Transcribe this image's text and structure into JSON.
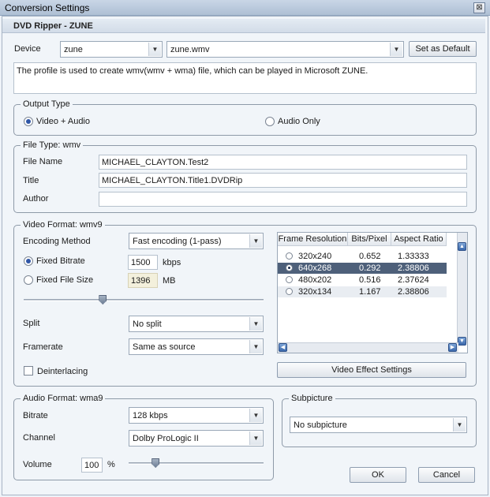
{
  "window": {
    "title": "Conversion Settings",
    "close_glyph": "⊠"
  },
  "header": {
    "title": "DVD Ripper - ZUNE"
  },
  "device": {
    "label": "Device",
    "value": "zune",
    "profile": "zune.wmv",
    "set_default_label": "Set as Default"
  },
  "description": "The profile is used to create wmv(wmv + wma) file, which can be played in Microsoft ZUNE.",
  "output_type": {
    "title": "Output Type",
    "video_audio_label": "Video + Audio",
    "audio_only_label": "Audio Only",
    "selected": "video_audio"
  },
  "file_type": {
    "title": "File Type: wmv",
    "file_name_label": "File Name",
    "file_name_value": "MICHAEL_CLAYTON.Test2",
    "title_label": "Title",
    "title_value": "MICHAEL_CLAYTON.Title1.DVDRip",
    "author_label": "Author",
    "author_value": ""
  },
  "video_format": {
    "title": "Video Format: wmv9",
    "encoding_label": "Encoding Method",
    "encoding_value": "Fast encoding (1-pass)",
    "fixed_bitrate_label": "Fixed Bitrate",
    "fixed_bitrate_value": "1500",
    "fixed_bitrate_unit": "kbps",
    "fixed_size_label": "Fixed File Size",
    "fixed_size_value": "1396",
    "fixed_size_unit": "MB",
    "bitrate_slider_fraction": 0.33,
    "split_label": "Split",
    "split_value": "No split",
    "framerate_label": "Framerate",
    "framerate_value": "Same as source",
    "deinterlacing_label": "Deinterlacing",
    "resolution_headers": [
      "Frame Resolution",
      "Bits/Pixel",
      "Aspect Ratio"
    ],
    "resolutions": [
      {
        "res": "320x240",
        "bpp": "0.652",
        "aspect": "1.33333",
        "selected": false
      },
      {
        "res": "640x268",
        "bpp": "0.292",
        "aspect": "2.38806",
        "selected": true
      },
      {
        "res": "480x202",
        "bpp": "0.516",
        "aspect": "2.37624",
        "selected": false
      },
      {
        "res": "320x134",
        "bpp": "1.167",
        "aspect": "2.38806",
        "selected": false
      }
    ],
    "effect_button_label": "Video Effect Settings"
  },
  "audio_format": {
    "title": "Audio Format: wma9",
    "bitrate_label": "Bitrate",
    "bitrate_value": "128 kbps",
    "channel_label": "Channel",
    "channel_value": "Dolby ProLogic II",
    "volume_label": "Volume",
    "volume_value": "100",
    "volume_unit": "%",
    "volume_slider_fraction": 0.2
  },
  "subpicture": {
    "title": "Subpicture",
    "value": "No subpicture"
  },
  "buttons": {
    "ok_label": "OK",
    "cancel_label": "Cancel"
  },
  "colors": {
    "selected_row": "#4e607a",
    "accent": "#2f56a6"
  }
}
